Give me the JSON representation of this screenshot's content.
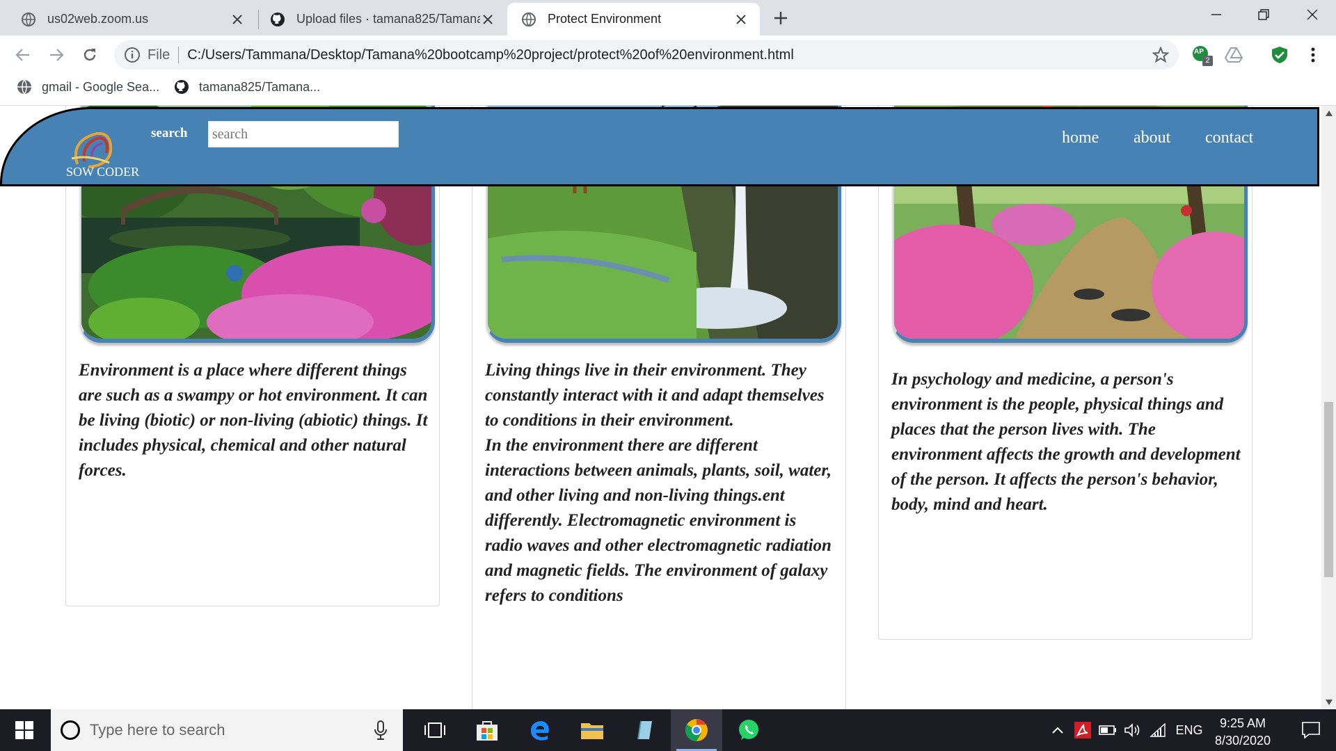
{
  "browser": {
    "tabs": [
      {
        "title": "us02web.zoom.us",
        "active": false
      },
      {
        "title": "Upload files · tamana825/Tamana",
        "active": false
      },
      {
        "title": "Protect Environment",
        "active": true
      }
    ],
    "address": {
      "scheme": "File",
      "url": "C:/Users/Tammana/Desktop/Tamana%20bootcamp%20project/protect%20of%20environment.html"
    },
    "extension_badge": "2",
    "extension_initials": "AP",
    "bookmarks": [
      {
        "label": "gmail - Google Sea..."
      },
      {
        "label": "tamana825/Tamana..."
      }
    ]
  },
  "site": {
    "logo_text": "SOW CODER",
    "search_label": "search",
    "search_placeholder": "search",
    "nav": [
      {
        "label": "home"
      },
      {
        "label": "about"
      },
      {
        "label": "contact"
      }
    ],
    "header_color": "#4682b4",
    "cards": [
      {
        "text": "Environment is a place where different things are such as a swampy or hot environment. It can be living (biotic) or non-living (abiotic) things. It includes physical, chemical and other natural forces."
      },
      {
        "text": "Living things live in their environment. They constantly interact with it and adapt themselves to conditions in their environment.",
        "text2": "In the environment there are different interactions between animals, plants, soil, water, and other living and non-living things.ent differently. Electromagnetic environment is radio waves and other electromagnetic radiation and magnetic fields. The environment of galaxy refers to conditions"
      },
      {
        "text": "In psychology and medicine, a person's environment is the people, physical things and places that the person lives with. The environment affects the growth and development of the person. It affects the person's behavior, body, mind and heart."
      }
    ]
  },
  "taskbar": {
    "search_placeholder": "Type here to search",
    "language": "ENG",
    "time": "9:25 AM",
    "date": "8/30/2020"
  }
}
